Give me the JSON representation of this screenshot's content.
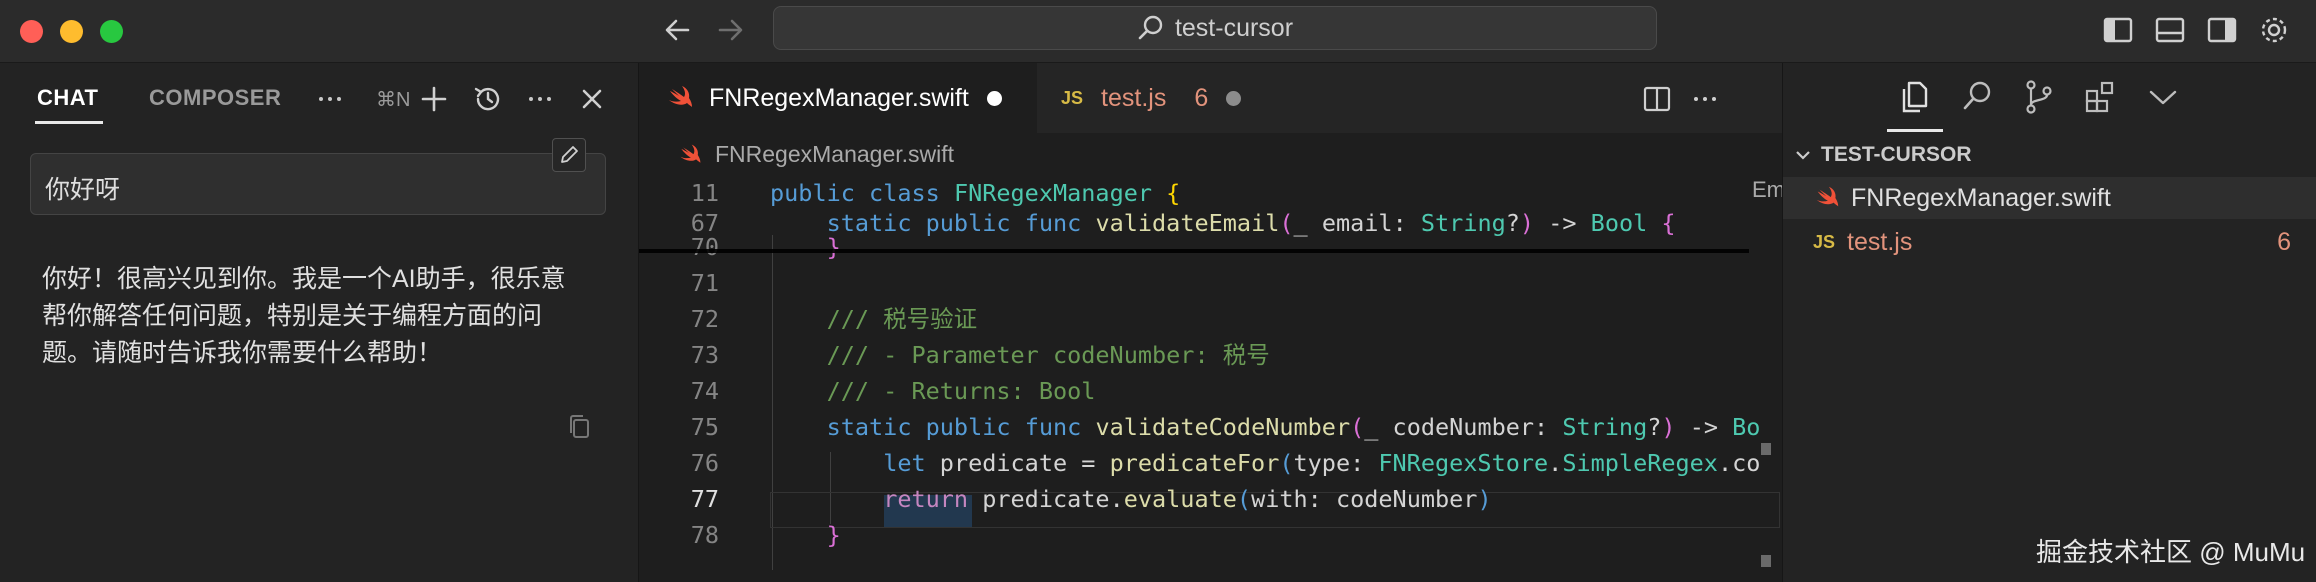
{
  "titlebar": {
    "search_text": "test-cursor"
  },
  "chat": {
    "tabs": [
      "CHAT",
      "COMPOSER"
    ],
    "shortcut": "⌘N",
    "user_message": "你好呀",
    "ai_lines": [
      "你好！很高兴见到你。我是一个AI助手，很乐意",
      "帮你解答任何问题，特别是关于编程方面的问",
      "题。请随时告诉我你需要什么帮助！"
    ]
  },
  "editor": {
    "tabs": [
      {
        "label": "FNRegexManager.swift",
        "modified": true,
        "active": true
      },
      {
        "label": "test.js",
        "badge": "JS",
        "errors": "6",
        "modified": true,
        "active": false
      }
    ],
    "breadcrumb": "FNRegexManager.swift",
    "right_clip": "Em",
    "lines": [
      {
        "n": "11",
        "tokens": [
          [
            "kwb",
            "public "
          ],
          [
            "kwb",
            "class "
          ],
          [
            "ty",
            "FNRegexManager "
          ],
          [
            "br",
            "{"
          ]
        ]
      },
      {
        "n": "67",
        "tokens": [
          [
            "",
            "    "
          ],
          [
            "kwb",
            "static "
          ],
          [
            "kwb",
            "public "
          ],
          [
            "kwb",
            "func "
          ],
          [
            "fn",
            "validateEmail"
          ],
          [
            "br2",
            "("
          ],
          [
            "",
            "_ email: "
          ],
          [
            "ty",
            "String"
          ],
          [
            "",
            "?"
          ],
          [
            "br2",
            ")"
          ],
          [
            "",
            " -> "
          ],
          [
            "ty",
            "Bool "
          ],
          [
            "br2",
            "{"
          ]
        ]
      },
      {
        "n": "70",
        "tokens": [
          [
            "",
            "    "
          ],
          [
            "br2",
            "}"
          ]
        ]
      },
      {
        "n": "71",
        "tokens": []
      },
      {
        "n": "72",
        "tokens": [
          [
            "",
            "    "
          ],
          [
            "cm",
            "/// 税号验证"
          ]
        ]
      },
      {
        "n": "73",
        "tokens": [
          [
            "",
            "    "
          ],
          [
            "cm",
            "/// - Parameter codeNumber: 税号"
          ]
        ]
      },
      {
        "n": "74",
        "tokens": [
          [
            "",
            "    "
          ],
          [
            "cm",
            "/// - Returns: Bool"
          ]
        ]
      },
      {
        "n": "75",
        "tokens": [
          [
            "",
            "    "
          ],
          [
            "kwb",
            "static "
          ],
          [
            "kwb",
            "public "
          ],
          [
            "kwb",
            "func "
          ],
          [
            "fn",
            "validateCodeNumber"
          ],
          [
            "br2",
            "("
          ],
          [
            "",
            "_ codeNumber: "
          ],
          [
            "ty",
            "String"
          ],
          [
            "",
            "?"
          ],
          [
            "br2",
            ")"
          ],
          [
            "",
            " -> "
          ],
          [
            "ty",
            "Bo"
          ]
        ]
      },
      {
        "n": "76",
        "tokens": [
          [
            "",
            "        "
          ],
          [
            "kwb",
            "let "
          ],
          [
            "",
            "predicate = "
          ],
          [
            "fn",
            "predicateFor"
          ],
          [
            "kwb",
            "("
          ],
          [
            "",
            "type: "
          ],
          [
            "ty",
            "FNRegexStore"
          ],
          [
            "",
            "."
          ],
          [
            "ty",
            "SimpleRegex"
          ],
          [
            "",
            "."
          ],
          [
            "",
            "co"
          ]
        ]
      },
      {
        "n": "77",
        "tokens": [
          [
            "",
            "        "
          ],
          [
            "kw",
            "return "
          ],
          [
            "",
            "predicate."
          ],
          [
            "fn",
            "evaluate"
          ],
          [
            "kwb",
            "("
          ],
          [
            "",
            "with: codeNumber"
          ],
          [
            "kwb",
            ")"
          ]
        ],
        "active": true
      },
      {
        "n": "78",
        "tokens": [
          [
            "",
            "    "
          ],
          [
            "br2",
            "}"
          ]
        ]
      }
    ]
  },
  "explorer": {
    "section_title": "TEST-CURSOR",
    "files": [
      {
        "name": "FNRegexManager.swift",
        "type": "swift"
      },
      {
        "name": "test.js",
        "type": "js",
        "badge": "JS",
        "count": "6"
      }
    ]
  },
  "watermark": "掘金技术社区 @ MuMu",
  "colors": {
    "accent_swift": "#f05138",
    "js_badge": "#d7ba46",
    "error_text": "#e2937c"
  }
}
